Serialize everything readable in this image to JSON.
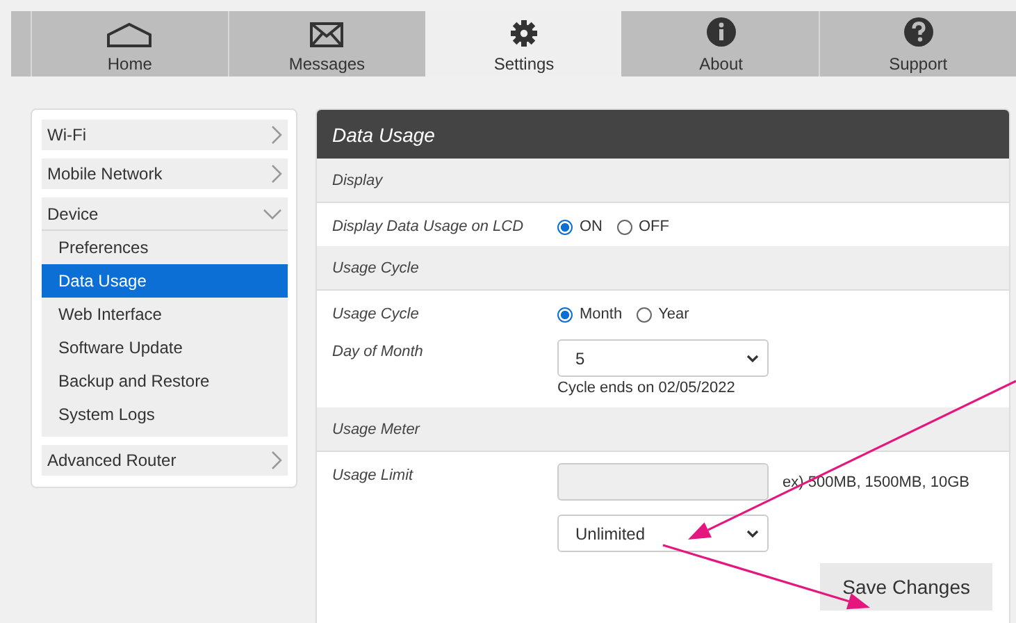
{
  "tabs": [
    {
      "label": "Home",
      "selected": false
    },
    {
      "label": "Messages",
      "selected": false
    },
    {
      "label": "Settings",
      "selected": true
    },
    {
      "label": "About",
      "selected": false
    },
    {
      "label": "Support",
      "selected": false
    }
  ],
  "sidebar": {
    "items": [
      {
        "label": "Wi-Fi",
        "expanded": false
      },
      {
        "label": "Mobile Network",
        "expanded": false
      },
      {
        "label": "Device",
        "expanded": true,
        "children": [
          {
            "label": "Preferences",
            "selected": false
          },
          {
            "label": "Data Usage",
            "selected": true
          },
          {
            "label": "Web Interface",
            "selected": false
          },
          {
            "label": "Software Update",
            "selected": false
          },
          {
            "label": "Backup and Restore",
            "selected": false
          },
          {
            "label": "System Logs",
            "selected": false
          }
        ]
      },
      {
        "label": "Advanced Router",
        "expanded": false
      }
    ]
  },
  "panel": {
    "title": "Data Usage",
    "sections": [
      {
        "title": "Display",
        "rows": [
          {
            "kind": "radio",
            "label": "Display Data Usage on LCD",
            "options": [
              {
                "label": "ON",
                "selected": true
              },
              {
                "label": "OFF",
                "selected": false
              }
            ]
          }
        ]
      },
      {
        "title": "Usage Cycle",
        "rows": [
          {
            "kind": "radio",
            "label": "Usage Cycle",
            "options": [
              {
                "label": "Month",
                "selected": true
              },
              {
                "label": "Year",
                "selected": false
              }
            ]
          },
          {
            "kind": "select",
            "label": "Day of Month",
            "value": "5",
            "note": "Cycle ends on 02/05/2022"
          }
        ]
      },
      {
        "title": "Usage Meter",
        "rows": [
          {
            "kind": "limit",
            "label": "Usage Limit",
            "input_disabled": true,
            "hint": "ex) 500MB, 1500MB, 10GB",
            "value": "Unlimited"
          }
        ]
      }
    ],
    "button": "Save Changes"
  }
}
